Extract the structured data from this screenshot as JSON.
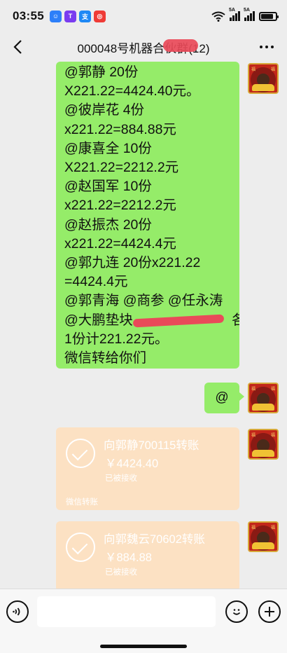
{
  "status_bar": {
    "time": "03:55",
    "apps": [
      {
        "name": "app-1",
        "color": "#2d7ff9",
        "glyph": "☺"
      },
      {
        "name": "app-2",
        "color": "#7a3cf0",
        "glyph": "T"
      },
      {
        "name": "app-3",
        "color": "#1e88f5",
        "glyph": "支"
      },
      {
        "name": "app-4",
        "color": "#ef3b36",
        "glyph": "◎"
      }
    ],
    "signal_label_1": "5A",
    "signal_label_2": "5A",
    "battery_level": 0.85
  },
  "nav": {
    "title": "000048号机器合伙群(12)",
    "back_icon": "chevron-left-icon",
    "more_icon": "more-icon"
  },
  "messages": {
    "text_lines": [
      "@郭静 20份",
      "X221.22=4424.40元。",
      "@彼岸花 4份",
      "x221.22=884.88元",
      "@康喜全 10份",
      "X221.22=2212.2元",
      "@赵国军 10份",
      "x221.22=2212.2元",
      "@赵振杰 20份",
      "x221.22=4424.4元",
      "@郭九连 20份x221.22",
      "=4424.4元",
      "@郭青海 @商参 @任永涛"
    ],
    "line_14_prefix": "@大鹏垫块",
    "line_14_suffix": " 各",
    "text_tail": [
      "1份计221.22元。",
      "微信转给你们"
    ],
    "at_message": "@",
    "transfers": [
      {
        "title": "向郭静700115转账",
        "amount": "￥4424.40",
        "status": "已被接收",
        "footer": "微信转账"
      },
      {
        "title": "向郭魏云70602转账",
        "amount": "￥884.88",
        "status": "已被接收"
      }
    ],
    "avatar_tag": "福"
  },
  "input_bar": {
    "voice_icon": "voice-icon",
    "emoji_icon": "emoji-icon",
    "plus_icon": "plus-icon"
  }
}
